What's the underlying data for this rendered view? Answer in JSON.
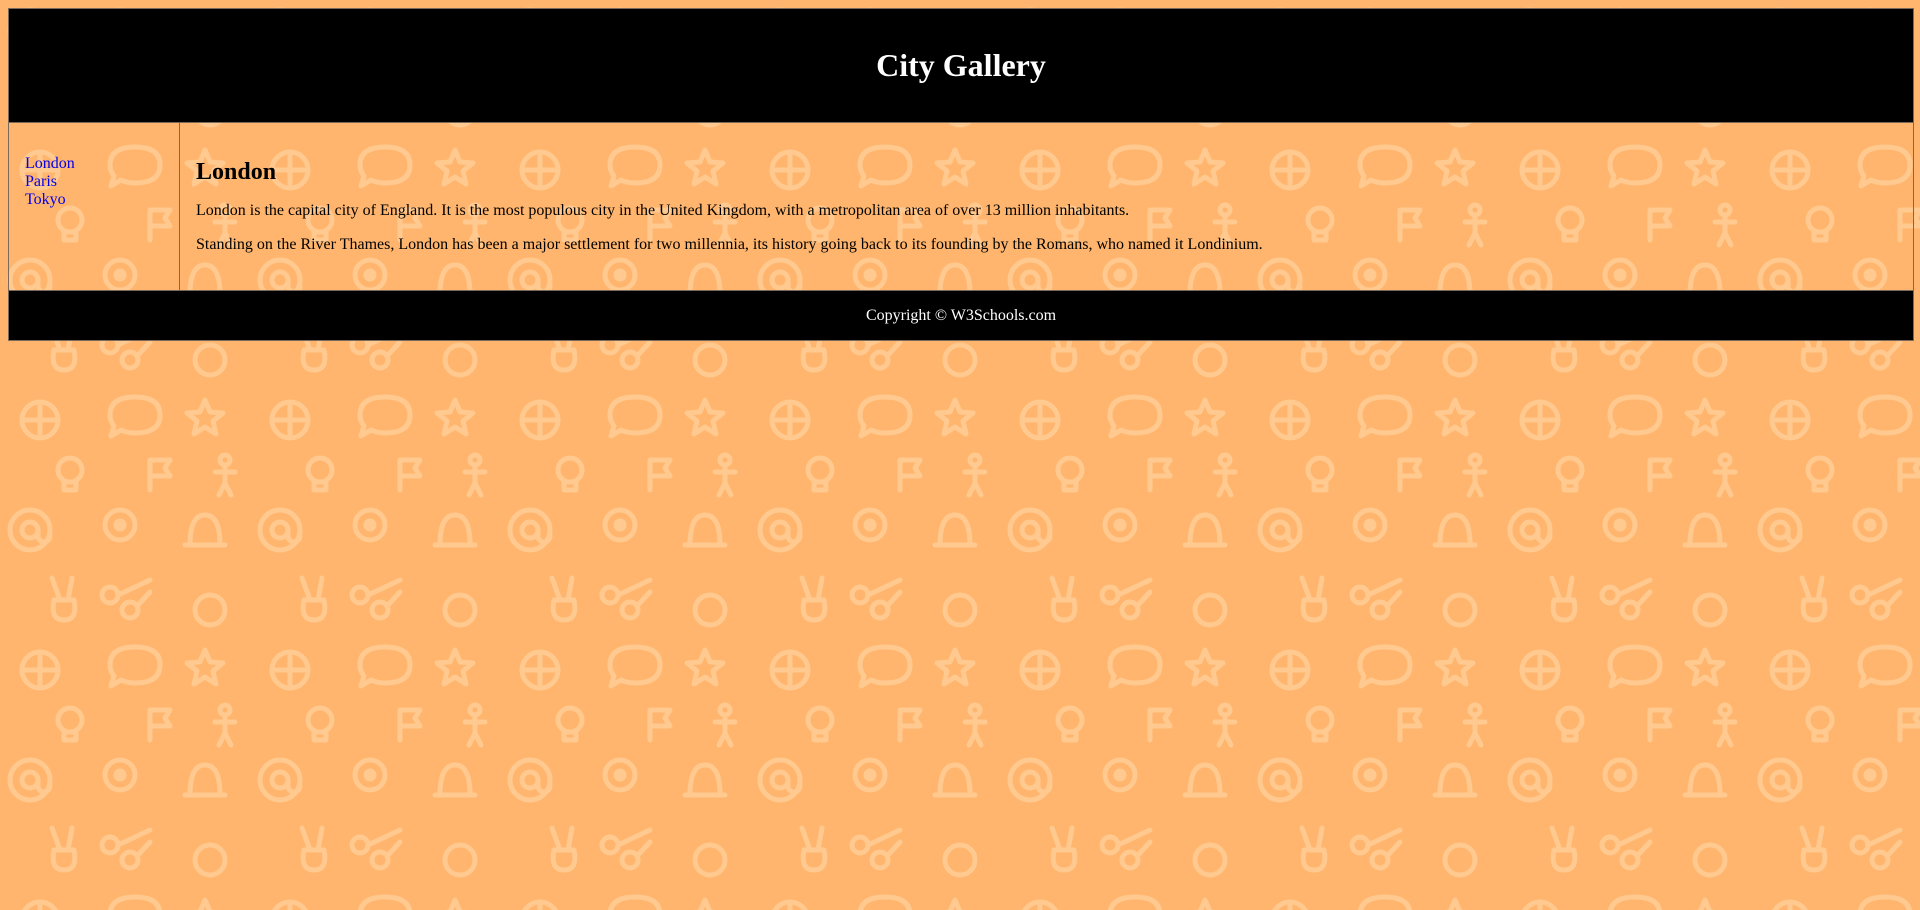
{
  "header": {
    "title": "City Gallery"
  },
  "nav": {
    "items": [
      {
        "label": "London"
      },
      {
        "label": "Paris"
      },
      {
        "label": "Tokyo"
      }
    ]
  },
  "article": {
    "heading": "London",
    "paragraphs": [
      "London is the capital city of England. It is the most populous city in the United Kingdom, with a metropolitan area of over 13 million inhabitants.",
      "Standing on the River Thames, London has been a major settlement for two millennia, its history going back to its founding by the Romans, who named it Londinium."
    ]
  },
  "footer": {
    "text": "Copyright © W3Schools.com"
  },
  "colors": {
    "background": "#ffb56d",
    "pattern": "#ffc98f",
    "header_bg": "#000000",
    "link": "#0000ee"
  }
}
